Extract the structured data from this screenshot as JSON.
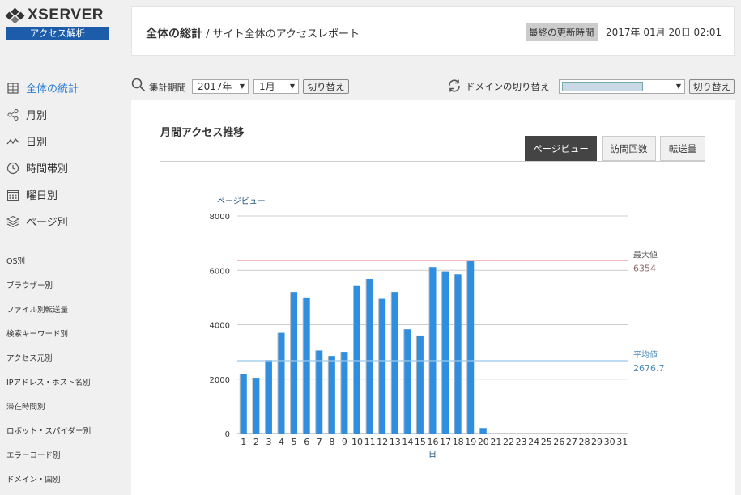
{
  "logo": {
    "brand": "XSERVER",
    "sub": "アクセス解析"
  },
  "nav_main": [
    {
      "label": "全体の統計",
      "icon": "building-icon",
      "active": true
    },
    {
      "label": "月別",
      "icon": "share-icon",
      "active": false
    },
    {
      "label": "日別",
      "icon": "line-chart-icon",
      "active": false
    },
    {
      "label": "時間帯別",
      "icon": "clock-icon",
      "active": false
    },
    {
      "label": "曜日別",
      "icon": "calendar-icon",
      "active": false
    },
    {
      "label": "ページ別",
      "icon": "layers-icon",
      "active": false
    }
  ],
  "nav_sub": [
    "OS別",
    "ブラウザー別",
    "ファイル別転送量",
    "検索キーワード別",
    "アクセス元別",
    "IPアドレス・ホスト名別",
    "滞在時間別",
    "ロボット・スパイダー別",
    "エラーコード別",
    "ドメイン・国別"
  ],
  "header": {
    "title": "全体の総計",
    "subtitle": "/ サイト全体のアクセスレポート",
    "updated_label": "最終の更新時間",
    "updated_value": "2017年 01月 20日 02:01"
  },
  "controls": {
    "period_label": "集計期間",
    "year": "2017年",
    "month": "1月",
    "switch_label": "切り替え",
    "domain_label": "ドメインの切り替え",
    "domain_value": "",
    "domain_switch_label": "切り替え"
  },
  "content": {
    "title": "月間アクセス推移",
    "tabs": [
      {
        "label": "ページビュー",
        "active": true
      },
      {
        "label": "訪問回数",
        "active": false
      },
      {
        "label": "転送量",
        "active": false
      }
    ]
  },
  "colors": {
    "accent": "#2a7ccf",
    "bar": "#2f8ee0",
    "max_line": "#f4b8b8",
    "avg_line": "#9cc8e8",
    "logo_bar": "#1c5ca8"
  },
  "chart_data": {
    "type": "bar",
    "ylabel": "ページビュー",
    "xlabel": "日",
    "ylim": [
      0,
      8000
    ],
    "yticks": [
      0,
      2000,
      4000,
      6000,
      8000
    ],
    "grid": true,
    "categories": [
      "1",
      "2",
      "3",
      "4",
      "5",
      "6",
      "7",
      "8",
      "9",
      "10",
      "11",
      "12",
      "13",
      "14",
      "15",
      "16",
      "17",
      "18",
      "19",
      "20",
      "21",
      "22",
      "23",
      "24",
      "25",
      "26",
      "27",
      "28",
      "29",
      "30",
      "31"
    ],
    "series": [
      {
        "values": [
          2200,
          2050,
          2700,
          3700,
          5200,
          5000,
          3050,
          2850,
          3000,
          5450,
          5680,
          4950,
          5200,
          3830,
          3600,
          6120,
          5960,
          5850,
          6354,
          200,
          0,
          0,
          0,
          0,
          0,
          0,
          0,
          0,
          0,
          0,
          0
        ]
      }
    ],
    "reference_lines": [
      {
        "label": "最大値",
        "value": 6354,
        "value_text": "6354"
      },
      {
        "label": "平均値",
        "value": 2676.7,
        "value_text": "2676.7"
      }
    ]
  }
}
